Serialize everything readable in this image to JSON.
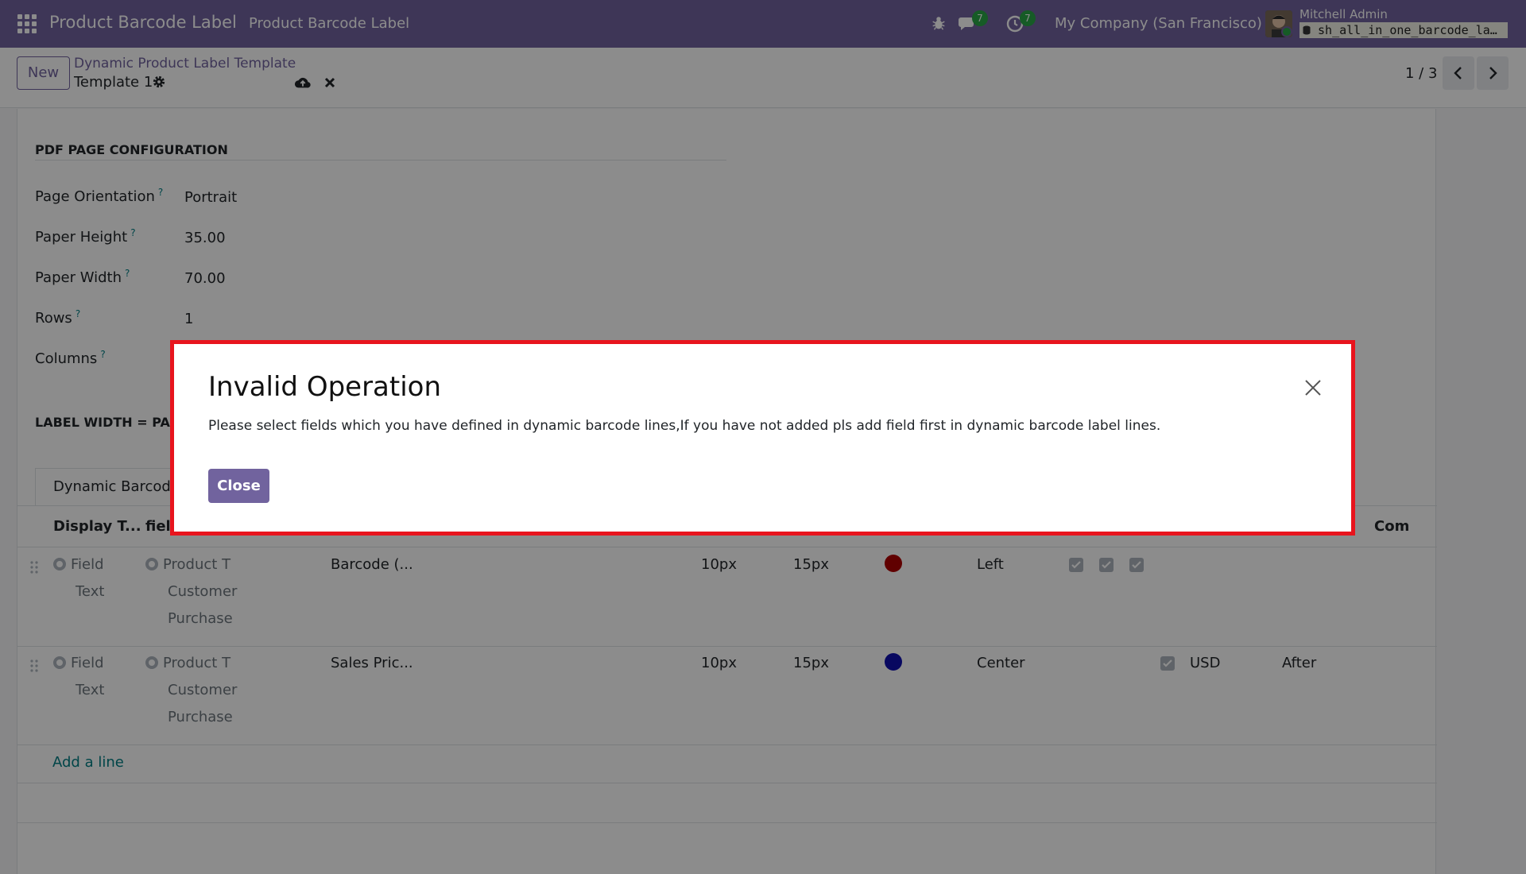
{
  "navbar": {
    "brand": "Product Barcode Label",
    "menu_item": "Product Barcode Label",
    "chat_count": "7",
    "activity_count": "7",
    "company": "My Company (San Francisco)",
    "user_name": "Mitchell Admin",
    "db_name": "sh_all_in_one_barcode_la…"
  },
  "control_panel": {
    "new_label": "New",
    "breadcrumb": "Dynamic Product Label Template",
    "record_name": "Template 1",
    "pager": "1 / 3"
  },
  "form": {
    "section1_title": "PDF PAGE CONFIGURATION",
    "fields": [
      {
        "label": "Page Orientation",
        "value": "Portrait"
      },
      {
        "label": "Paper Height",
        "value": "35.00"
      },
      {
        "label": "Paper Width",
        "value": "70.00"
      },
      {
        "label": "Rows",
        "value": "1"
      },
      {
        "label": "Columns",
        "value": ""
      }
    ],
    "help_mark": "?",
    "section2_title": "LABEL WIDTH = PAP",
    "tab_label": "Dynamic Barcode",
    "columns": {
      "display_type": "Display T...",
      "field": "field",
      "last": "Com"
    },
    "rows": [
      {
        "display_options": [
          "Field",
          "Text"
        ],
        "field_options": [
          "Product T",
          "Customer",
          "Purchase"
        ],
        "field_value": "Barcode (...",
        "size1": "10px",
        "size2": "15px",
        "color": "#b00000",
        "align": "Left",
        "checks": [
          true,
          true,
          true
        ],
        "currency": "",
        "position": ""
      },
      {
        "display_options": [
          "Field",
          "Text"
        ],
        "field_options": [
          "Product T",
          "Customer",
          "Purchase"
        ],
        "field_value": "Sales Pric...",
        "size1": "10px",
        "size2": "15px",
        "color": "#1010b0",
        "align": "Center",
        "checks": [
          true
        ],
        "currency": "USD",
        "position": "After"
      }
    ],
    "add_line": "Add a line"
  },
  "dialog": {
    "title": "Invalid Operation",
    "message": "Please select fields which you have defined in dynamic barcode lines,If you have not added pls add field first in dynamic barcode label lines.",
    "close_label": "Close"
  }
}
